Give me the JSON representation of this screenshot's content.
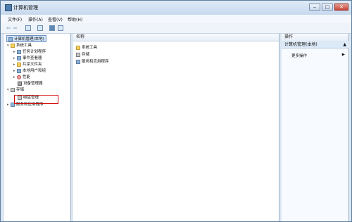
{
  "window": {
    "title": "计算机管理"
  },
  "menu": {
    "file": "文件(F)",
    "action": "操作(A)",
    "view": "查看(V)",
    "help": "帮助(H)"
  },
  "left_tree": {
    "root": "计算机管理(本地)",
    "system_tools": "系统工具",
    "task_scheduler": "任务计划程序",
    "event_viewer": "事件查看器",
    "shared_folders": "共享文件夹",
    "local_users_groups": "本地用户和组",
    "performance": "性能",
    "device_manager": "设备管理器",
    "storage": "存储",
    "disk_management": "磁盘管理",
    "services_apps": "服务和应用程序"
  },
  "center_list": {
    "header": "名称",
    "items": [
      "系统工具",
      "存储",
      "服务和应用程序"
    ]
  },
  "actions": {
    "header": "操作",
    "section_title": "计算机管理(本地)",
    "more_actions": "更多操作"
  },
  "colors": {
    "highlight": "#d20000"
  }
}
